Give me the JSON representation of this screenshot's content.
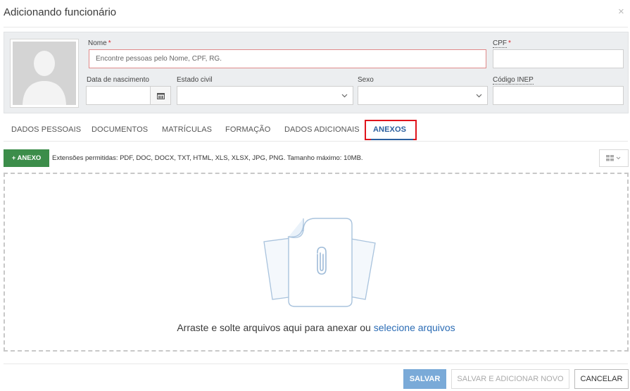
{
  "dialog": {
    "title": "Adicionando funcionário",
    "close_symbol": "×"
  },
  "form": {
    "nome": {
      "label": "Nome",
      "required_mark": "*",
      "placeholder": "Encontre pessoas pelo Nome, CPF, RG."
    },
    "cpf": {
      "label": "CPF",
      "required_mark": "*"
    },
    "data_nascimento": {
      "label": "Data de nascimento"
    },
    "estado_civil": {
      "label": "Estado civil"
    },
    "sexo": {
      "label": "Sexo"
    },
    "codigo_inep": {
      "label": "Código INEP"
    }
  },
  "tabs": [
    {
      "label": "DADOS PESSOAIS"
    },
    {
      "label": "DOCUMENTOS"
    },
    {
      "label": "MATRÍCULAS"
    },
    {
      "label": "FORMAÇÃO"
    },
    {
      "label": "DADOS ADICIONAIS"
    },
    {
      "label": "ANEXOS",
      "active": true
    }
  ],
  "attachments": {
    "add_button": "+ ANEXO",
    "hint": "Extensões permitidas: PDF, DOC, DOCX, TXT, HTML, XLS, XLSX, JPG, PNG. Tamanho máximo: 10MB.",
    "drop_text": "Arraste e solte arquivos aqui para anexar ou ",
    "drop_link": "selecione arquivos"
  },
  "footer": {
    "save": "SALVAR",
    "save_and_new": "SALVAR E ADICIONAR NOVO",
    "cancel": "CANCELAR"
  },
  "colors": {
    "accent": "#2b5f9e",
    "add_button": "#3c8d4a",
    "save_button": "#7aaad8",
    "highlight_box": "#e0141c",
    "required": "#d9262b"
  },
  "icons": [
    "avatar-placeholder-icon",
    "calendar-icon",
    "chevron-down-icon",
    "plus-icon",
    "grid-view-icon",
    "file-attachment-icon"
  ]
}
